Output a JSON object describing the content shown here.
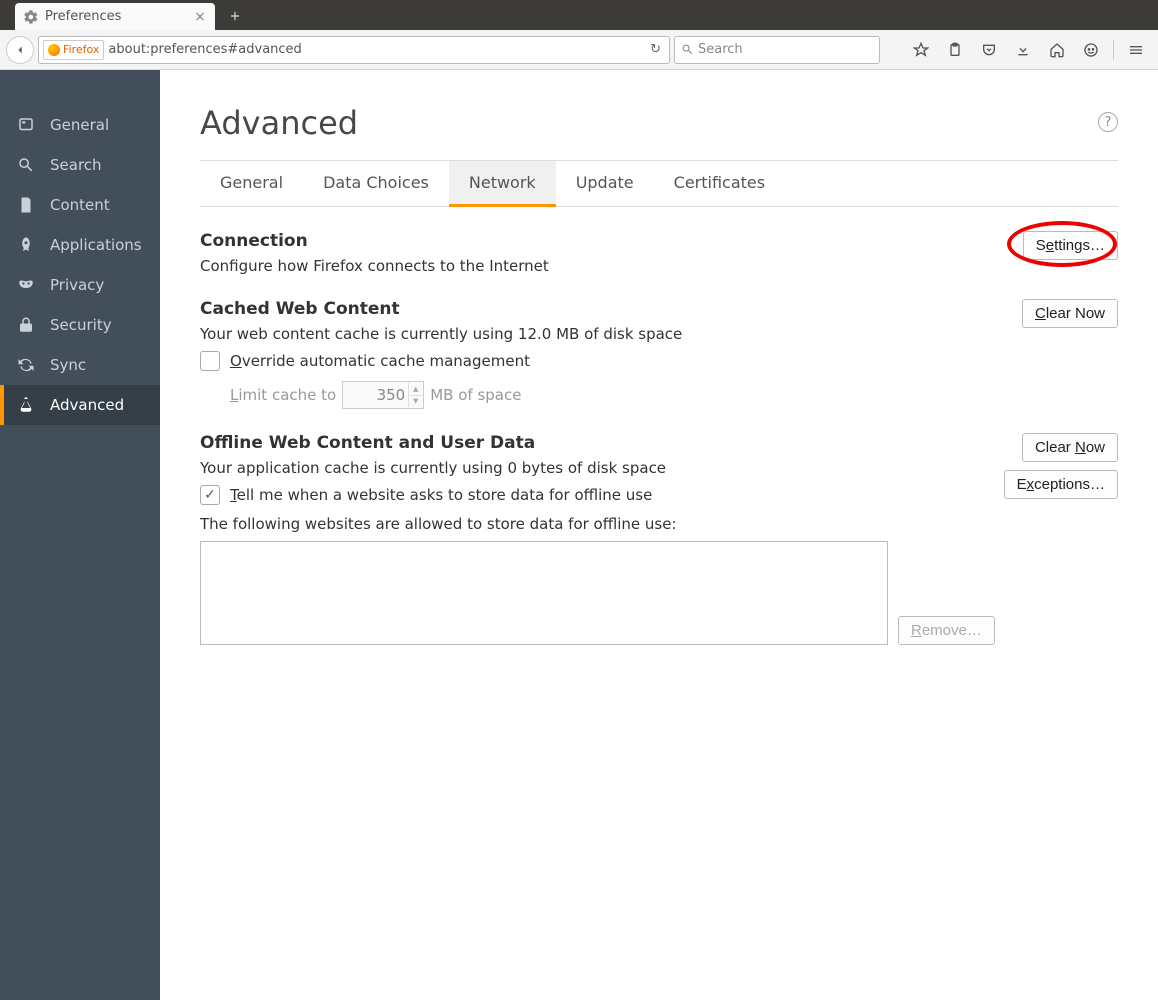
{
  "browser": {
    "tab_title": "Preferences",
    "url_label": "Firefox",
    "url": "about:preferences#advanced",
    "search_placeholder": "Search"
  },
  "sidebar": {
    "items": [
      {
        "label": "General"
      },
      {
        "label": "Search"
      },
      {
        "label": "Content"
      },
      {
        "label": "Applications"
      },
      {
        "label": "Privacy"
      },
      {
        "label": "Security"
      },
      {
        "label": "Sync"
      },
      {
        "label": "Advanced"
      }
    ]
  },
  "page": {
    "title": "Advanced",
    "tabs": [
      "General",
      "Data Choices",
      "Network",
      "Update",
      "Certificates"
    ],
    "active_tab": "Network"
  },
  "connection": {
    "title": "Connection",
    "desc": "Configure how Firefox connects to the Internet",
    "settings_btn_pre": "S",
    "settings_btn_u": "e",
    "settings_btn_post": "ttings…"
  },
  "cache": {
    "title": "Cached Web Content",
    "desc": "Your web content cache is currently using 12.0 MB of disk space",
    "clear_btn_u": "C",
    "clear_btn_post": "lear Now",
    "override_u": "O",
    "override_post": "verride automatic cache management",
    "limit_pre_u": "L",
    "limit_pre_post": "imit cache to",
    "limit_value": "350",
    "limit_suffix": "MB of space"
  },
  "offline": {
    "title": "Offline Web Content and User Data",
    "desc": "Your application cache is currently using 0 bytes of disk space",
    "clear_pre": "Clear ",
    "clear_u": "N",
    "clear_post": "ow",
    "tell_u": "T",
    "tell_post": "ell me when a website asks to store data for offline use",
    "exceptions_pre": "E",
    "exceptions_u": "x",
    "exceptions_post": "ceptions…",
    "allowed_label": "The following websites are allowed to store data for offline use:",
    "remove_u": "R",
    "remove_post": "emove…"
  }
}
